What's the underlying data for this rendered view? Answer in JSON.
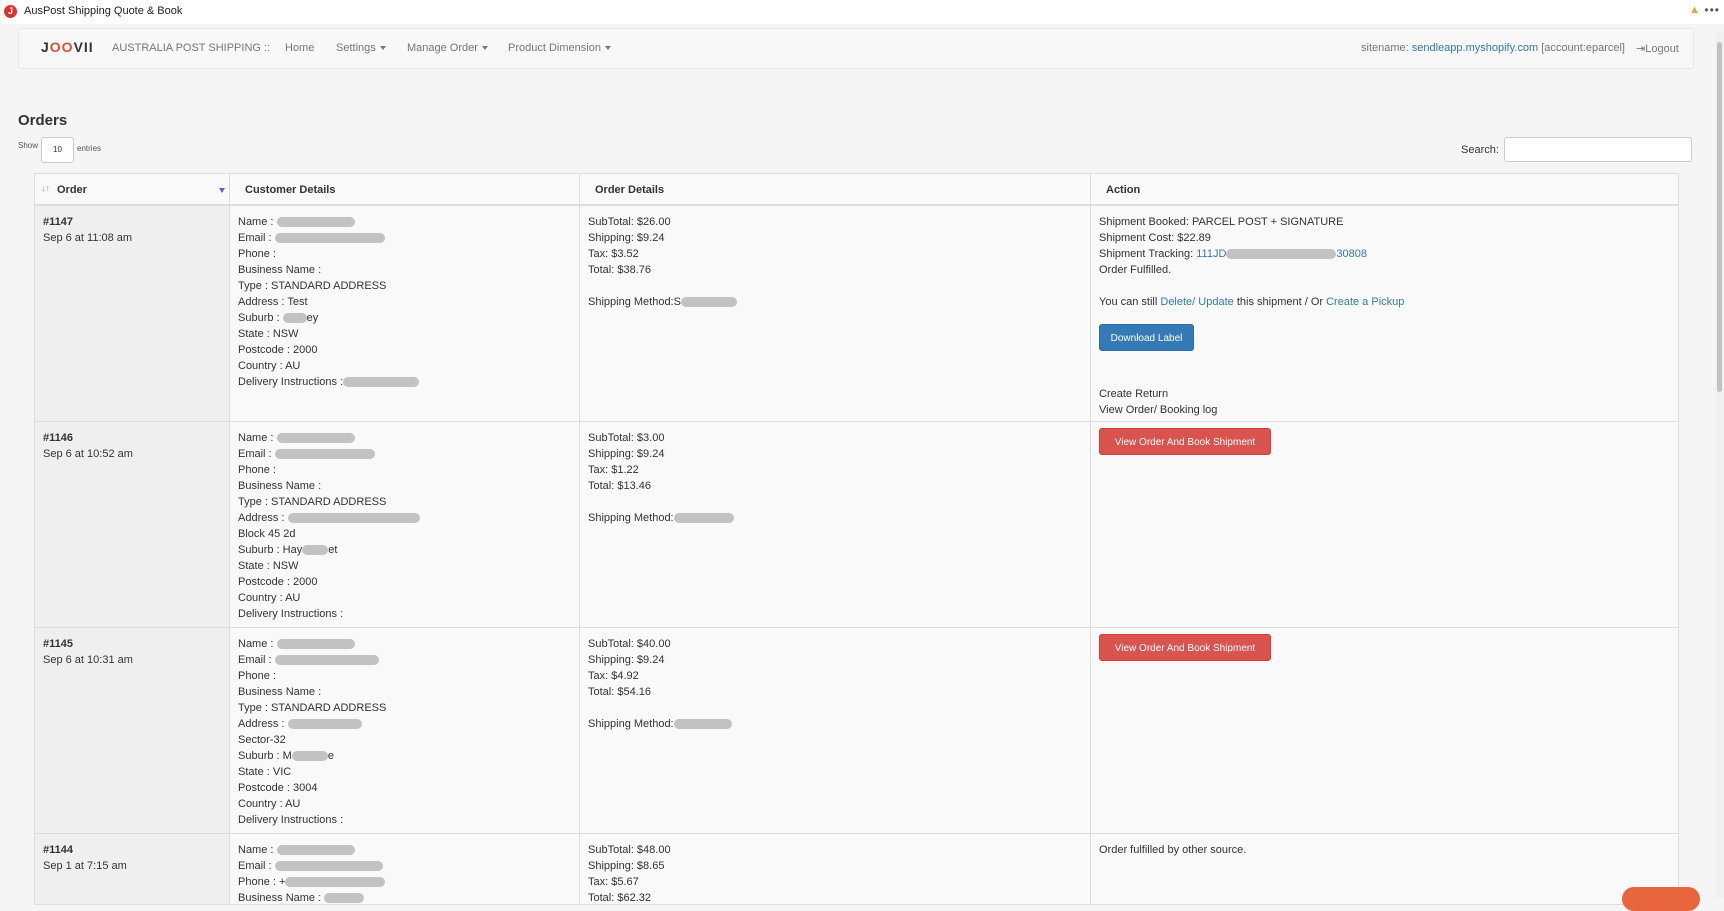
{
  "window": {
    "title": "AusPost Shipping Quote & Book",
    "app_icon_glyph": "J"
  },
  "navbar": {
    "logo": {
      "j": "J",
      "oo": "OO",
      "rest": "VII"
    },
    "brand": "AUSTRALIA POST SHIPPING ::",
    "items": [
      {
        "label": "Home",
        "dropdown": false
      },
      {
        "label": "Settings",
        "dropdown": true
      },
      {
        "label": "Manage Order",
        "dropdown": true
      },
      {
        "label": "Product Dimension",
        "dropdown": true
      }
    ],
    "sitename_label": "sitename:",
    "sitename_link": "sendleapp.myshopify.com",
    "account": "[account:eparcel]",
    "logout": "Logout"
  },
  "page": {
    "heading": "Orders",
    "show_label": "Show",
    "show_value": "10",
    "entries_label": "entries",
    "search_label": "Search:"
  },
  "table": {
    "columns": [
      "Order",
      "Customer Details",
      "Order Details",
      "Action"
    ],
    "rows": [
      {
        "order": "#1147",
        "date": "Sep 6 at 11:08 am",
        "customer": {
          "name": "Name :",
          "email": "Email :",
          "phone": "Phone :",
          "business": "Business Name :",
          "type": "Type : STANDARD ADDRESS",
          "address": "Address : Test",
          "suburb_pre": "Suburb :",
          "suburb_post": "ey",
          "state": "State : NSW",
          "postcode": "Postcode : 2000",
          "country": "Country : AU",
          "instructions": "Delivery Instructions :"
        },
        "details": {
          "subtotal": "SubTotal: $26.00",
          "shipping": "Shipping: $9.24",
          "tax": "Tax: $3.52",
          "total": "Total: $38.76",
          "method": "Shipping Method:S"
        },
        "action": {
          "booked": "Shipment Booked: PARCEL POST + SIGNATURE",
          "cost": "Shipment Cost: $22.89",
          "tracking_label": "Shipment Tracking:",
          "tracking_pre": "111JD",
          "tracking_post": "30808",
          "fulfilled": "Order Fulfilled.",
          "still_pre": "You can still",
          "delete": "Delete/",
          "update": "Update",
          "still_mid": "this shipment / Or",
          "pickup": "Create a Pickup",
          "download": "Download Label",
          "create_return": "Create Return",
          "view_log": "View Order/ Booking log"
        }
      },
      {
        "order": "#1146",
        "date": "Sep 6 at 10:52 am",
        "customer": {
          "name": "Name :",
          "email": "Email :",
          "phone": "Phone :",
          "business": "Business Name :",
          "type": "Type : STANDARD ADDRESS",
          "address": "Address :",
          "address2": "Block 45 2d",
          "suburb_pre": "Suburb : Hay",
          "suburb_post": "et",
          "state": "State : NSW",
          "postcode": "Postcode : 2000",
          "country": "Country : AU",
          "instructions": "Delivery Instructions :"
        },
        "details": {
          "subtotal": "SubTotal: $3.00",
          "shipping": "Shipping: $9.24",
          "tax": "Tax: $1.22",
          "total": "Total: $13.46",
          "method": "Shipping Method:"
        },
        "action": {
          "button": "View Order And Book Shipment"
        }
      },
      {
        "order": "#1145",
        "date": "Sep 6 at 10:31 am",
        "customer": {
          "name": "Name :",
          "email": "Email :",
          "phone": "Phone :",
          "business": "Business Name :",
          "type": "Type : STANDARD ADDRESS",
          "address": "Address :",
          "address2": "Sector-32",
          "suburb_pre": "Suburb : M",
          "suburb_post": "e",
          "state": "State : VIC",
          "postcode": "Postcode : 3004",
          "country": "Country : AU",
          "instructions": "Delivery Instructions :"
        },
        "details": {
          "subtotal": "SubTotal: $40.00",
          "shipping": "Shipping: $9.24",
          "tax": "Tax: $4.92",
          "total": "Total: $54.16",
          "method": "Shipping Method:"
        },
        "action": {
          "button": "View Order And Book Shipment"
        }
      },
      {
        "order": "#1144",
        "date": "Sep 1 at 7:15 am",
        "customer": {
          "name": "Name :",
          "email": "Email :",
          "phone": "Phone : +",
          "business": "Business Name :"
        },
        "details": {
          "subtotal": "SubTotal: $48.00",
          "shipping": "Shipping: $8.65",
          "tax": "Tax: $5.67",
          "total": "Total: $62.32"
        },
        "action": {
          "text": "Order fulfilled by other source."
        }
      }
    ]
  },
  "colors": {
    "link": "#337ab7",
    "primary": "#337ab7",
    "danger": "#d9534f",
    "brand_accent": "#e04e39"
  }
}
